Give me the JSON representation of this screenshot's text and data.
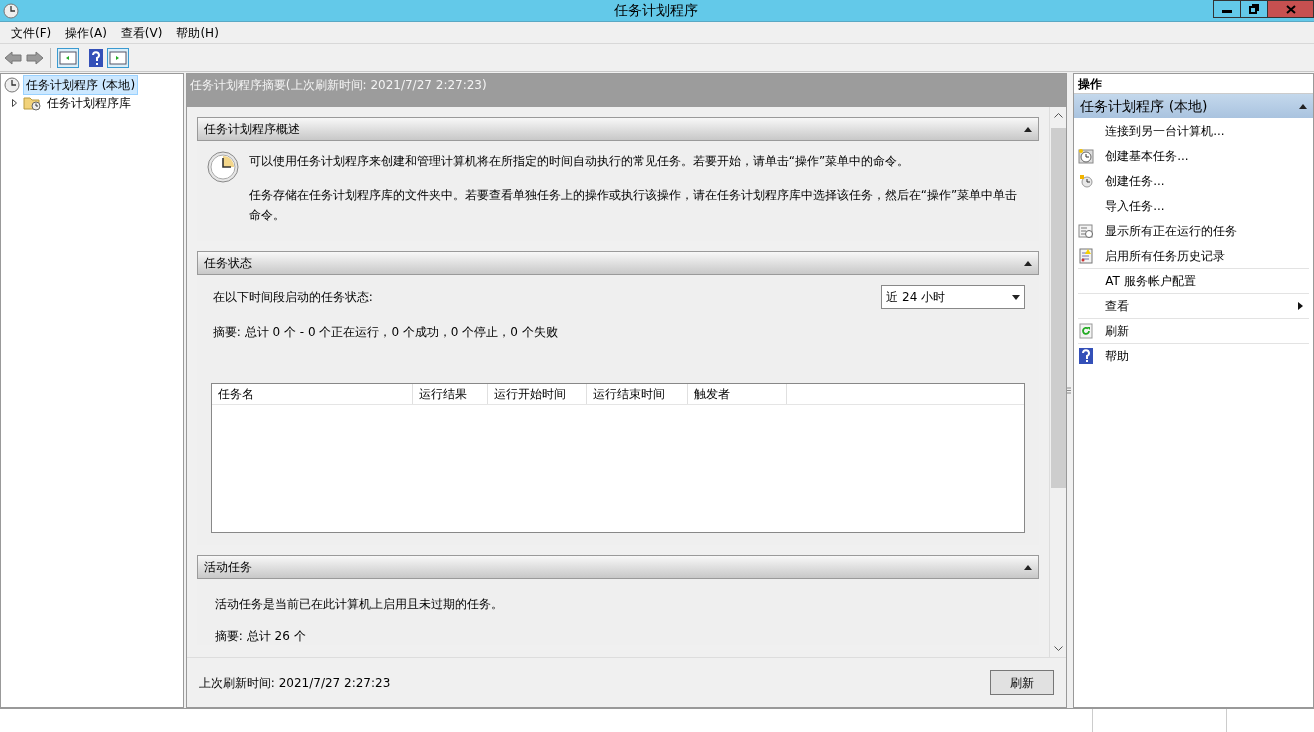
{
  "window": {
    "title": "任务计划程序"
  },
  "menu": [
    "文件(F)",
    "操作(A)",
    "查看(V)",
    "帮助(H)"
  ],
  "tree": [
    {
      "label": "任务计划程序 (本地)",
      "selected": true,
      "children": [
        {
          "label": "任务计划程序库",
          "selected": false,
          "expanded": false
        }
      ]
    }
  ],
  "summary": {
    "header": "任务计划程序摘要(上次刷新时间: 2021/7/27 2:27:23)",
    "sections": [
      {
        "title": "任务计划程序概述",
        "kind": "overview",
        "paragraphs": [
          "可以使用任务计划程序来创建和管理计算机将在所指定的时间自动执行的常见任务。若要开始，请单击“操作”菜单中的命令。",
          "任务存储在任务计划程序库的文件夹中。若要查看单独任务上的操作或执行该操作，请在任务计划程序库中选择该任务，然后在“操作”菜单中单击命令。"
        ]
      },
      {
        "title": "任务状态",
        "kind": "status",
        "label": "在以下时间段启动的任务状态:",
        "period": "近 24 小时",
        "summary": "摘要: 总计 0 个 - 0 个正在运行，0 个成功，0 个停止，0 个失败",
        "columns": [
          "任务名",
          "运行结果",
          "运行开始时间",
          "运行结束时间",
          "触发者"
        ]
      },
      {
        "title": "活动任务",
        "kind": "active",
        "paragraphs": [
          "活动任务是当前已在此计算机上启用且未过期的任务。",
          "摘要: 总计 26 个"
        ]
      }
    ],
    "footer": "上次刷新时间: 2021/7/27 2:27:23",
    "refresh_button": "刷新"
  },
  "actions": {
    "title": "操作",
    "group": "任务计划程序 (本地)",
    "items": [
      {
        "label": "连接到另一台计算机..."
      },
      {
        "label": "创建基本任务..."
      },
      {
        "label": "创建任务..."
      },
      {
        "label": "导入任务..."
      },
      {
        "label": "显示所有正在运行的任务"
      },
      {
        "label": "启用所有任务历史记录"
      },
      {
        "label": "AT 服务帐户配置"
      },
      {
        "label": "查看",
        "submenu": true
      },
      {
        "label": "刷新"
      },
      {
        "label": "帮助"
      }
    ]
  }
}
